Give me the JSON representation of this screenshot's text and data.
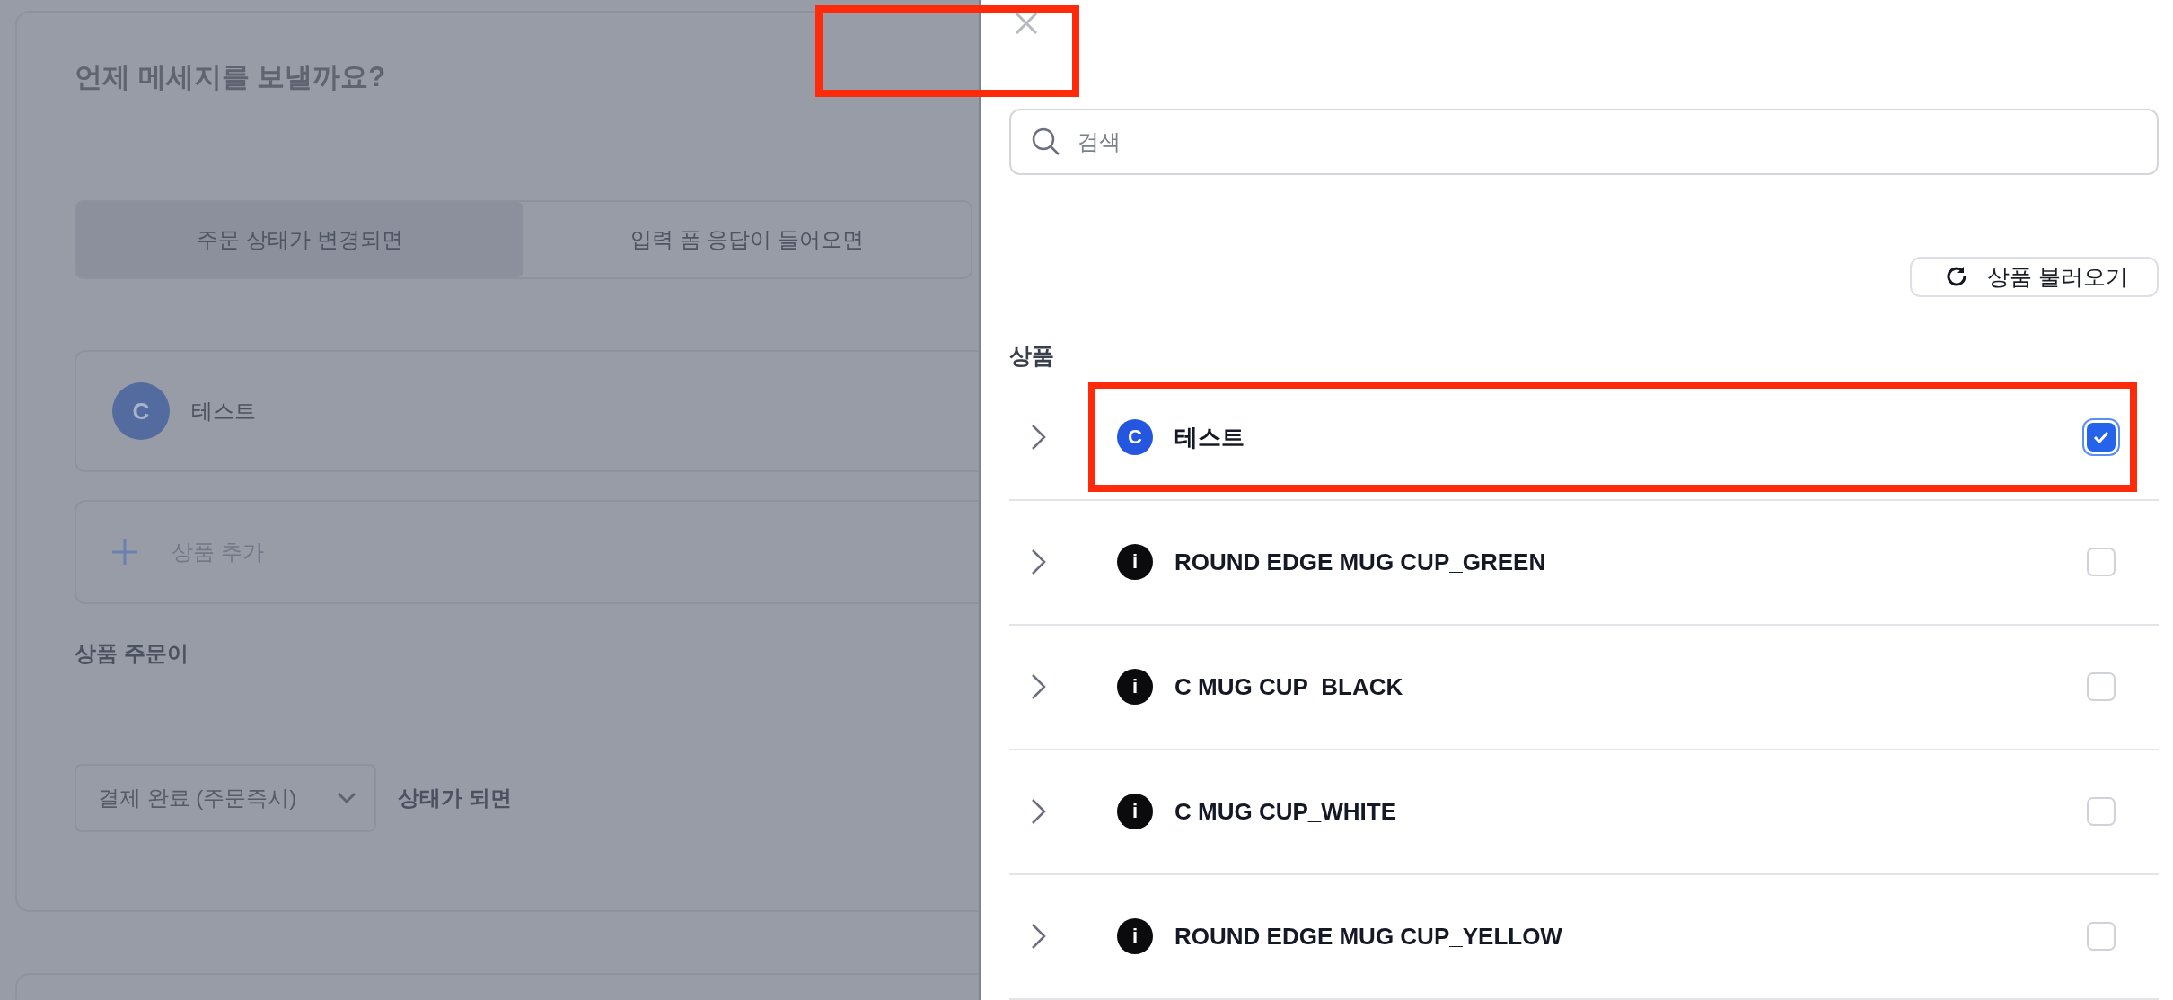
{
  "question": "언제 메세지를 보낼까요?",
  "trigger_tabs": [
    {
      "label": "주문 상태가 변경되면",
      "selected": true
    },
    {
      "label": "입력 폼 응답이 들어오면",
      "selected": false
    }
  ],
  "selected_products": [
    {
      "badge": "C",
      "name": "테스트"
    }
  ],
  "add_product": "상품 추가",
  "order_label": "상품 주문이",
  "status_select": {
    "value": "결제 완료 (주문즉시)"
  },
  "status_suffix": "상태가 되면",
  "drawer": {
    "close_highlighted": true,
    "search": {
      "placeholder": "검색"
    },
    "load_button": "상품 불러오기",
    "section_label": "상품",
    "products": [
      {
        "badge": "C",
        "color": "#2456e0",
        "name": "테스트",
        "checked": true,
        "highlighted": true
      },
      {
        "badge": "i",
        "color": "#0b0b0d",
        "name": "ROUND EDGE MUG CUP_GREEN",
        "checked": false,
        "highlighted": false
      },
      {
        "badge": "i",
        "color": "#0b0b0d",
        "name": "C MUG CUP_BLACK",
        "checked": false,
        "highlighted": false
      },
      {
        "badge": "i",
        "color": "#0b0b0d",
        "name": "C MUG CUP_WHITE",
        "checked": false,
        "highlighted": false
      },
      {
        "badge": "i",
        "color": "#0b0b0d",
        "name": "ROUND EDGE MUG CUP_YELLOW",
        "checked": false,
        "highlighted": false
      }
    ]
  }
}
